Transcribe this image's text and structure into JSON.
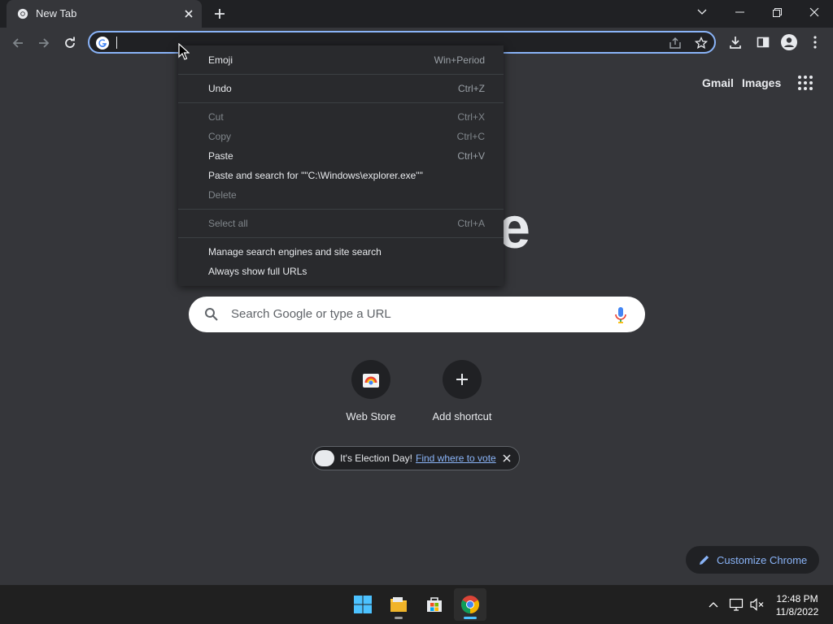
{
  "tab": {
    "title": "New Tab",
    "close_icon": "close-icon",
    "favicon": "chrome-icon"
  },
  "toolbar": {
    "omnibox_value": "",
    "icons": [
      "back-icon",
      "forward-icon",
      "reload-icon",
      "google-g-icon",
      "share-icon",
      "star-icon",
      "download-icon",
      "side-panel-icon",
      "profile-icon",
      "menu-icon"
    ]
  },
  "context_menu": {
    "items": [
      {
        "label": "Emoji",
        "shortcut": "Win+Period",
        "enabled": true
      },
      {
        "label": "Undo",
        "shortcut": "Ctrl+Z",
        "enabled": true
      },
      {
        "label": "Cut",
        "shortcut": "Ctrl+X",
        "enabled": false
      },
      {
        "label": "Copy",
        "shortcut": "Ctrl+C",
        "enabled": false
      },
      {
        "label": "Paste",
        "shortcut": "Ctrl+V",
        "enabled": true
      },
      {
        "label": "Paste and search for \"\"C:\\Windows\\explorer.exe\"\"",
        "shortcut": "",
        "enabled": true
      },
      {
        "label": "Delete",
        "shortcut": "",
        "enabled": false
      },
      {
        "label": "Select all",
        "shortcut": "Ctrl+A",
        "enabled": false
      },
      {
        "label": "Manage search engines and site search",
        "shortcut": "",
        "enabled": true
      },
      {
        "label": "Always show full URLs",
        "shortcut": "",
        "enabled": true
      }
    ]
  },
  "ntp": {
    "links": {
      "gmail": "Gmail",
      "images": "Images"
    },
    "logo_fragment": "e",
    "search_placeholder": "Search Google or type a URL",
    "shortcuts": [
      {
        "label": "Web Store"
      },
      {
        "label": "Add shortcut"
      }
    ],
    "promo": {
      "text": "It's Election Day!",
      "link": "Find where to vote"
    },
    "customize_label": "Customize Chrome"
  },
  "taskbar": {
    "apps": [
      "windows-start-icon",
      "file-explorer-icon",
      "microsoft-store-icon",
      "chrome-icon"
    ],
    "time": "12:48 PM",
    "date": "11/8/2022"
  },
  "colors": {
    "accent": "#8ab4f8",
    "background": "#35363a",
    "frame": "#202124",
    "menu": "#292a2d"
  }
}
